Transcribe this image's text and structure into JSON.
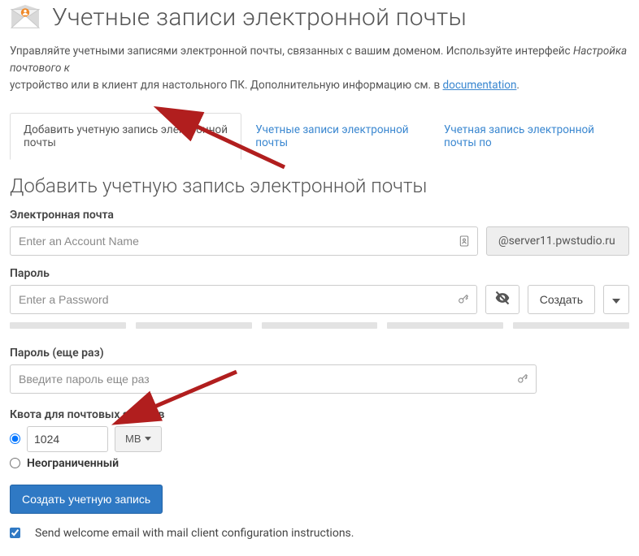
{
  "header": {
    "title": "Учетные записи электронной почты"
  },
  "intro": {
    "prefix": "Управляйте учетными записями электронной почты, связанных с вашим доменом. Используйте интерфейс ",
    "em": "Настройка почтового к",
    "line2_prefix": "устройство или в клиент для настольного ПК. Дополнительную информацию см. в ",
    "doc_link_text": "documentation",
    "period": "."
  },
  "tabs": {
    "add": "Добавить учетную запись электронной почты",
    "list": "Учетные записи электронной почты",
    "default": "Учетная запись электронной почты по"
  },
  "section": {
    "title": "Добавить учетную запись электронной почты"
  },
  "email": {
    "label": "Электронная почта",
    "placeholder": "Enter an Account Name",
    "domain": "@server11.pwstudio.ru"
  },
  "password": {
    "label": "Пароль",
    "placeholder": "Enter a Password",
    "generate_label": "Создать"
  },
  "password_confirm": {
    "label": "Пароль (еще раз)",
    "placeholder": "Введите пароль еще раз"
  },
  "quota": {
    "label": "Квота для почтовых ящиков",
    "value": "1024",
    "unit": "MB",
    "unlimited": "Неограниченный"
  },
  "actions": {
    "create": "Создать учетную запись"
  },
  "welcome": {
    "label": "Send welcome email with mail client configuration instructions."
  }
}
